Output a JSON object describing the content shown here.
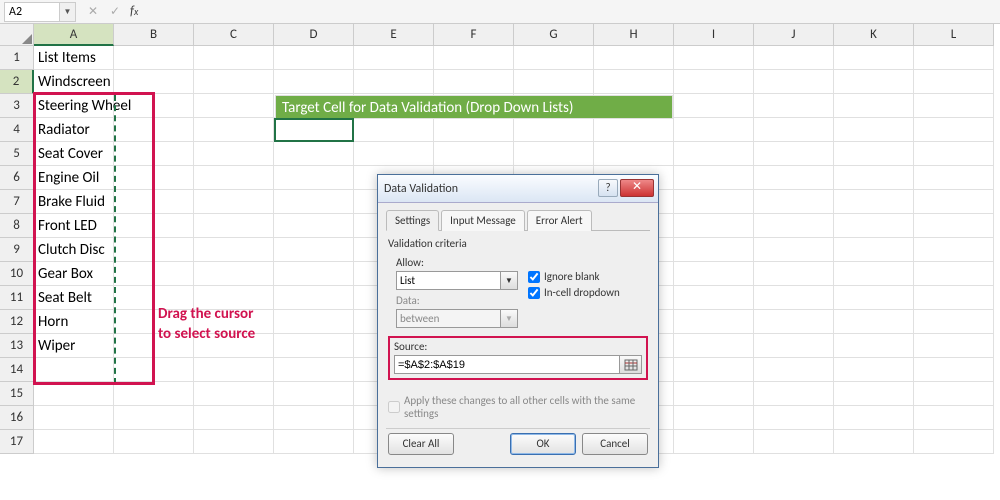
{
  "namebox": "A2",
  "formula": "",
  "columns": [
    "A",
    "B",
    "C",
    "D",
    "E",
    "F",
    "G",
    "H",
    "I",
    "J",
    "K",
    "L"
  ],
  "selected_col_idx": 0,
  "rows_count": 17,
  "selected_row_idx": 1,
  "list_header": "List Items",
  "list_items": [
    "Windscreen",
    "Steering Wheel",
    "Radiator",
    "Seat Cover",
    "Engine Oil",
    "Brake Fluid",
    "Front LED",
    "Clutch Disc",
    "Gear Box",
    "Seat Belt",
    "Horn",
    "Wiper"
  ],
  "banner_text": "Target Cell for Data Validation (Drop Down Lists)",
  "annotation": {
    "line1": "Drag the cursor",
    "line2": "to select source"
  },
  "dialog": {
    "title": "Data Validation",
    "tabs": [
      "Settings",
      "Input Message",
      "Error Alert"
    ],
    "active_tab": 0,
    "criteria_label": "Validation criteria",
    "allow_label": "Allow:",
    "allow_value": "List",
    "data_label": "Data:",
    "data_value": "between",
    "ignore_blank": {
      "label": "Ignore blank",
      "checked": true
    },
    "incell": {
      "label": "In-cell dropdown",
      "checked": true
    },
    "source_label": "Source:",
    "source_value": "=$A$2:$A$19",
    "apply_label": "Apply these changes to all other cells with the same settings",
    "buttons": {
      "clear": "Clear All",
      "ok": "OK",
      "cancel": "Cancel"
    }
  }
}
